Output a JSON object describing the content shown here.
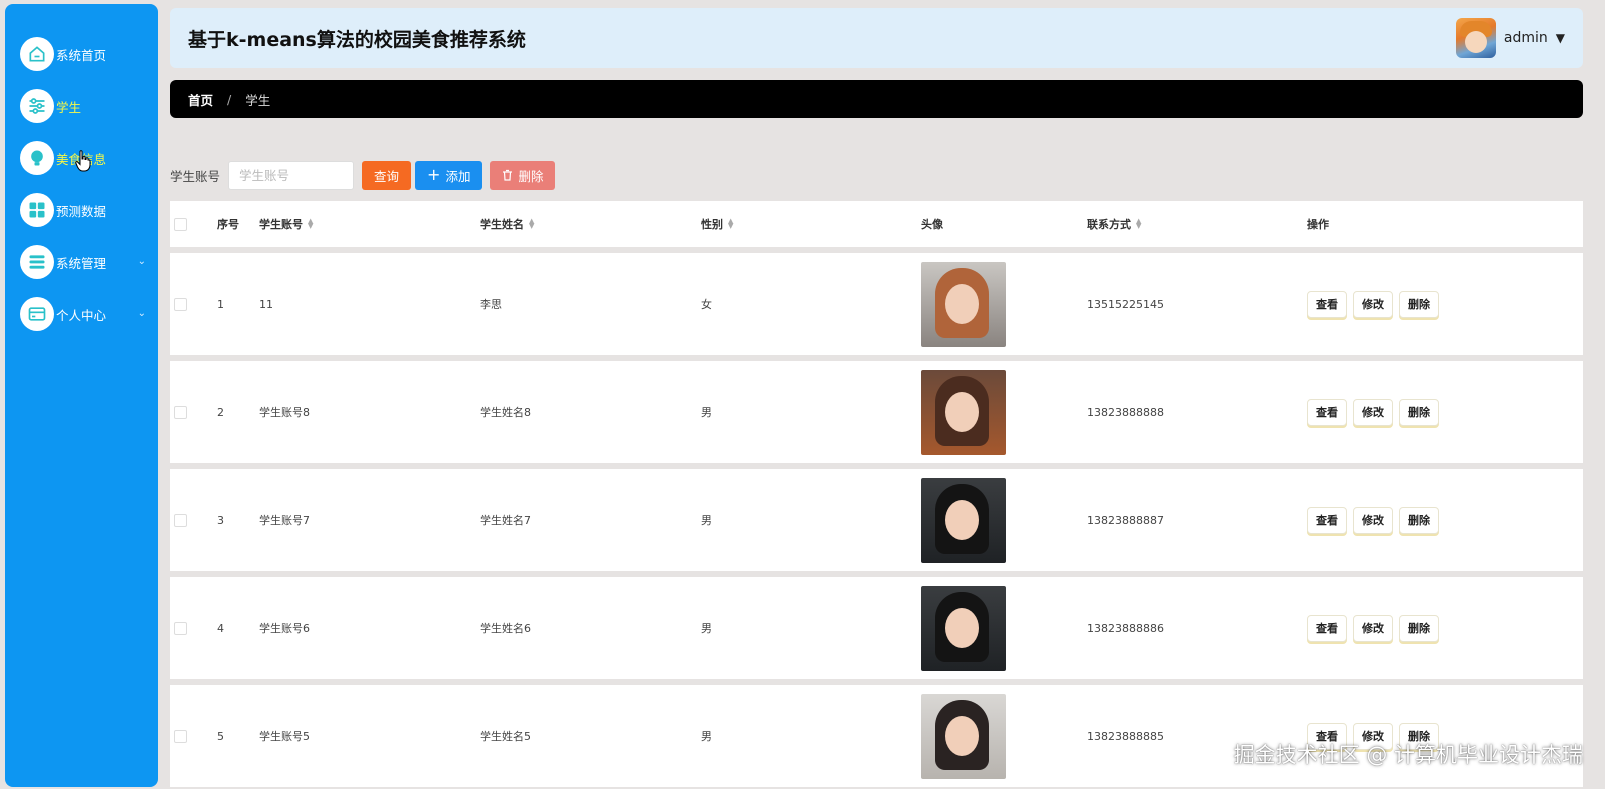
{
  "sidebar": {
    "items": [
      {
        "label": "系统首页",
        "icon": "home-icon",
        "highlight": false,
        "chevron": false
      },
      {
        "label": "学生",
        "icon": "sliders-icon",
        "highlight": true,
        "chevron": false
      },
      {
        "label": "美食信息",
        "icon": "lightbulb-icon",
        "highlight": true,
        "chevron": false
      },
      {
        "label": "预测数据",
        "icon": "grid-icon",
        "highlight": false,
        "chevron": false
      },
      {
        "label": "系统管理",
        "icon": "menu-icon",
        "highlight": false,
        "chevron": true
      },
      {
        "label": "个人中心",
        "icon": "card-icon",
        "highlight": false,
        "chevron": true
      }
    ],
    "chevron": "⌄"
  },
  "header": {
    "title": "基于k-means算法的校园美食推荐系统",
    "user": "admin",
    "caret": "▼"
  },
  "breadcrumb": {
    "home": "首页",
    "sep": "/",
    "current": "学生"
  },
  "search": {
    "label": "学生账号",
    "placeholder": "学生账号",
    "query_label": "查询",
    "add_label": "添加",
    "delete_label": "删除"
  },
  "table": {
    "columns": {
      "index": "序号",
      "account": "学生账号",
      "name": "学生姓名",
      "gender": "性别",
      "avatar": "头像",
      "phone": "联系方式",
      "actions": "操作"
    },
    "rows": [
      {
        "index": "1",
        "account": "11",
        "name": "李思",
        "gender": "女",
        "phone": "13515225145"
      },
      {
        "index": "2",
        "account": "学生账号8",
        "name": "学生姓名8",
        "gender": "男",
        "phone": "13823888888"
      },
      {
        "index": "3",
        "account": "学生账号7",
        "name": "学生姓名7",
        "gender": "男",
        "phone": "13823888887"
      },
      {
        "index": "4",
        "account": "学生账号6",
        "name": "学生姓名6",
        "gender": "男",
        "phone": "13823888886"
      },
      {
        "index": "5",
        "account": "学生账号5",
        "name": "学生姓名5",
        "gender": "男",
        "phone": "13823888885"
      }
    ],
    "actions": {
      "view": "查看",
      "edit": "修改",
      "delete": "删除"
    }
  },
  "watermark": "掘金技术社区 @ 计算机毕业设计杰瑞",
  "colors": {
    "sidebar_bg": "#0d96f2",
    "header_bg": "#deeefa",
    "breadcrumb_bg": "#000000",
    "query_btn": "#f56a22",
    "add_btn": "#1a8ff0",
    "delete_btn": "#ea7f78",
    "highlight_text": "#f5f84a"
  }
}
